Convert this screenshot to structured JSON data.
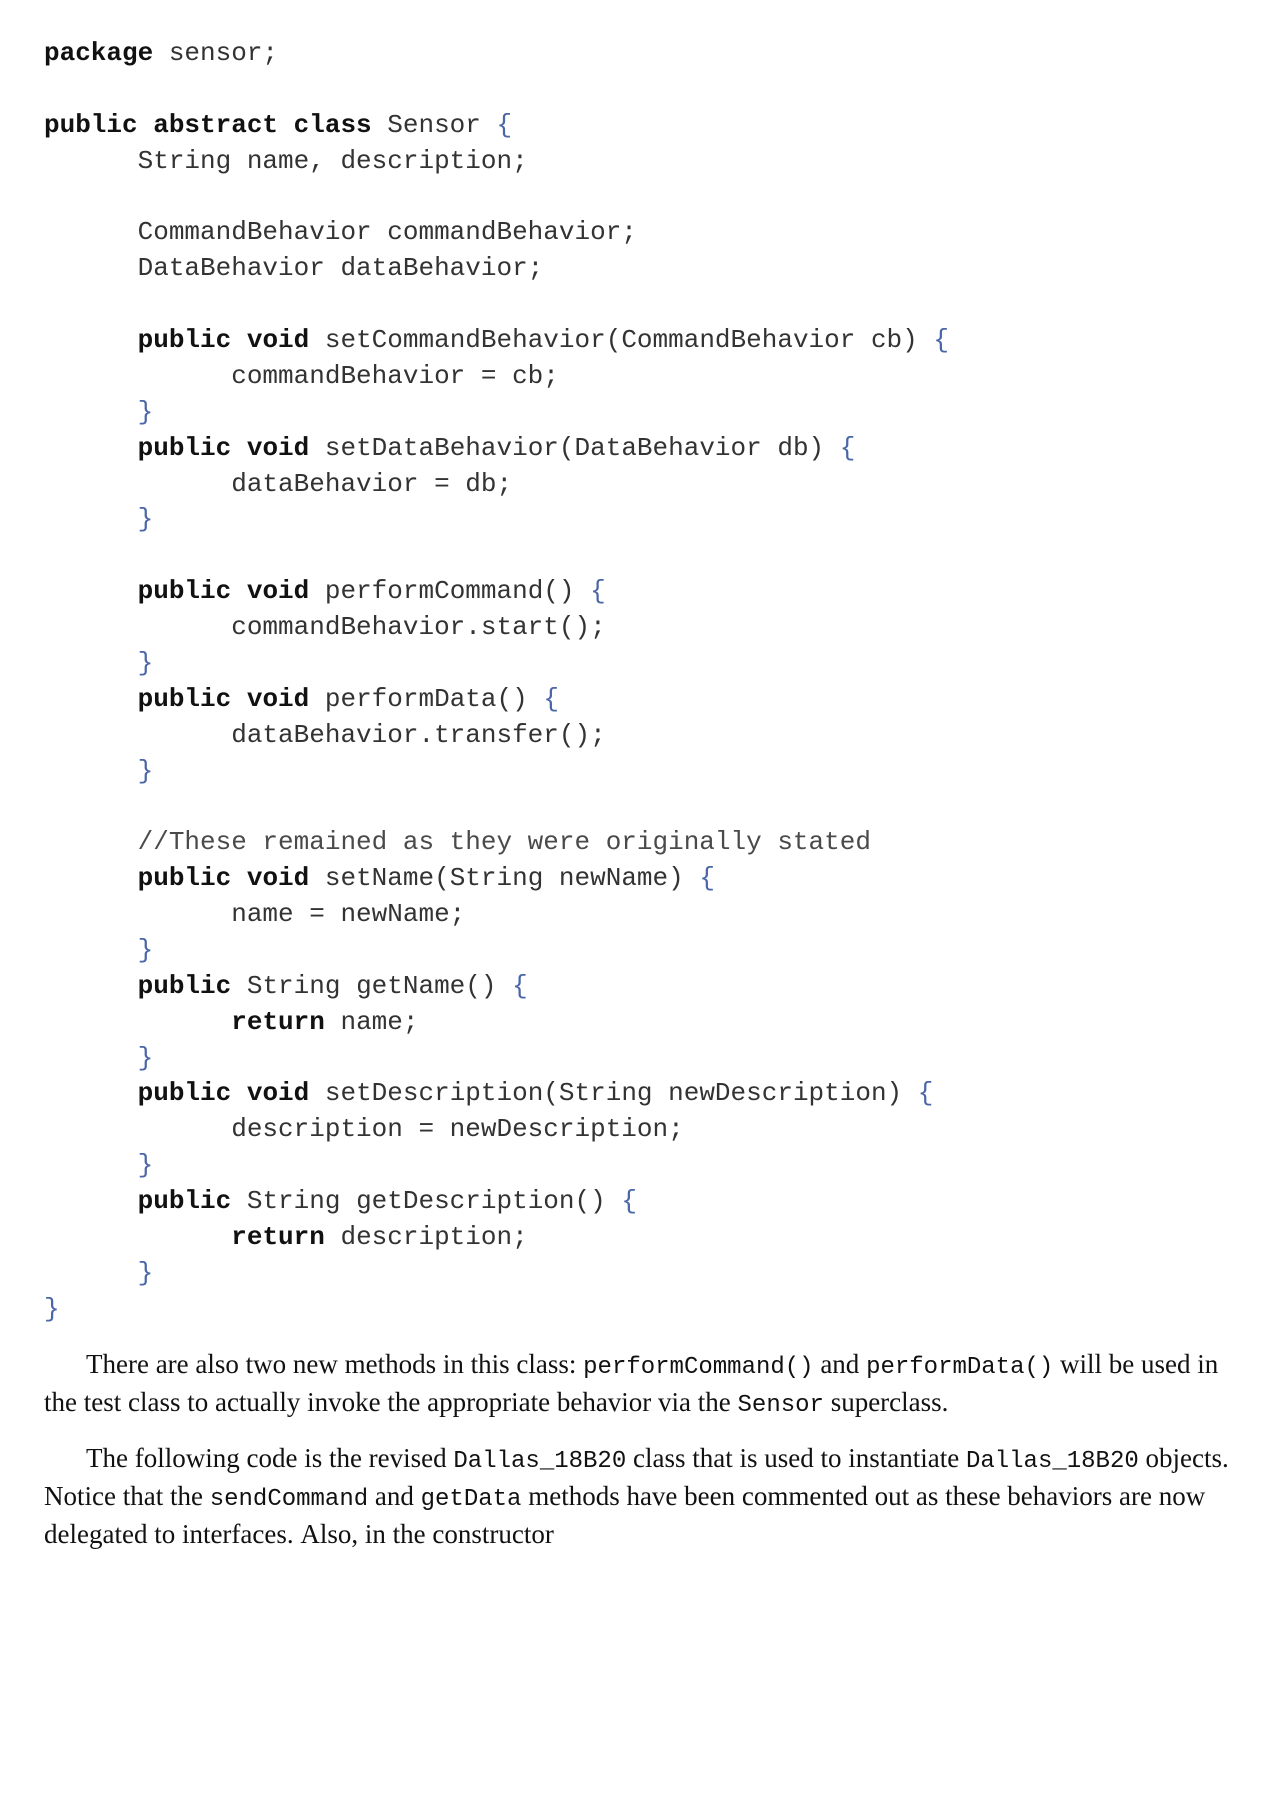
{
  "code": {
    "l01a": "package",
    "l01b": " sensor;",
    "l02_blank": "",
    "l03a": "public abstract class",
    "l03b": " Sensor ",
    "l04": "      String name, description;",
    "l05_blank": "",
    "l06": "      CommandBehavior commandBehavior;",
    "l07": "      DataBehavior dataBehavior;",
    "l08_blank": "",
    "l09a": "      ",
    "l09b": "public void",
    "l09c": " setCommandBehavior(CommandBehavior cb) ",
    "l10": "            commandBehavior = cb;",
    "l11": "      ",
    "l12a": "      ",
    "l12b": "public void",
    "l12c": " setDataBehavior(DataBehavior db) ",
    "l13": "            dataBehavior = db;",
    "l14": "      ",
    "l15_blank": "",
    "l16a": "      ",
    "l16b": "public void",
    "l16c": " performCommand() ",
    "l17": "            commandBehavior.start();",
    "l18": "      ",
    "l19a": "      ",
    "l19b": "public void",
    "l19c": " performData() ",
    "l20": "            dataBehavior.transfer();",
    "l21": "      ",
    "l22_blank": "",
    "l23": "      //These remained as they were originally stated",
    "l24a": "      ",
    "l24b": "public void",
    "l24c": " setName(String newName) ",
    "l25": "            name = newName;",
    "l26": "      ",
    "l27a": "      ",
    "l27b": "public",
    "l27c": " String getName() ",
    "l28a": "            ",
    "l28b": "return",
    "l28c": " name;",
    "l29": "      ",
    "l30a": "      ",
    "l30b": "public void",
    "l30c": " setDescription(String newDescription) ",
    "l31": "            description = newDescription;",
    "l32": "      ",
    "l33a": "      ",
    "l33b": "public",
    "l33c": " String getDescription() ",
    "l34a": "            ",
    "l34b": "return",
    "l34c": " description;",
    "l35": "      ",
    "l36": "",
    "brace_open": "{",
    "brace_close": "}"
  },
  "para1": {
    "t1": "There are also two new methods in this class: ",
    "c1": "performCommand()",
    "t2": " and ",
    "c2": "performData()",
    "t3": " will be used in the test class to actually invoke the appropriate behavior via the ",
    "c3": "Sensor",
    "t4": " superclass."
  },
  "para2": {
    "t1": "The following code is the revised ",
    "c1": "Dallas_18B20",
    "t2": " class that is used to instantiate ",
    "c2": "Dallas_18B20",
    "t3": " objects. Notice that the ",
    "c3": "sendCommand",
    "t4": " and ",
    "c4": "getData",
    "t5": " methods have been commented out as these behaviors are now delegated to interfaces. Also, in the constructor"
  }
}
